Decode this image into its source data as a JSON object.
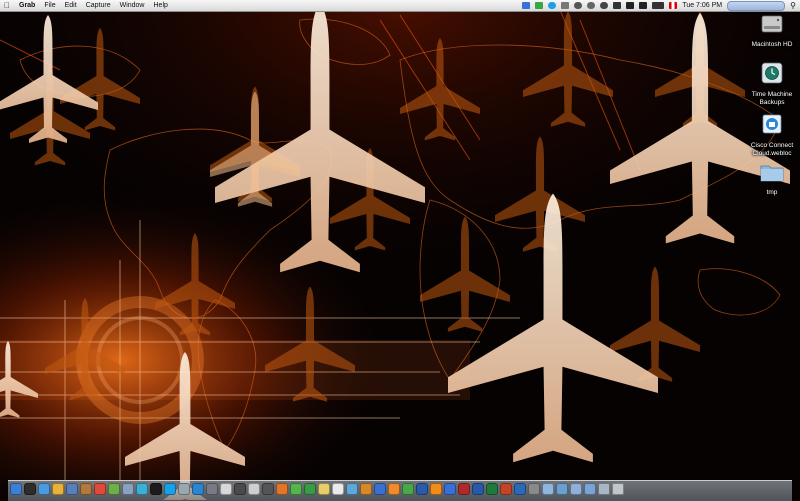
{
  "menubar": {
    "app_name": "Grab",
    "menus": [
      "File",
      "Edit",
      "Capture",
      "Window",
      "Help"
    ],
    "clock": "Tue 7:06 PM"
  },
  "desktop_icons": [
    {
      "name": "macintosh-hd",
      "label": "Macintosh HD",
      "icon": "hard-drive-icon"
    },
    {
      "name": "time-machine-backups",
      "label": "Time Machine Backups",
      "icon": "time-machine-icon"
    },
    {
      "name": "cisco-connect-cloud",
      "label": "Cisco Connect Cloud.webloc",
      "icon": "webloc-icon"
    },
    {
      "name": "tmp",
      "label": "tmp",
      "icon": "folder-icon"
    }
  ],
  "dock": {
    "apps": [
      "finder",
      "dashboard",
      "safari",
      "chrome",
      "mail",
      "contacts",
      "calendar",
      "photos",
      "preview",
      "itunes",
      "terminal",
      "skype",
      "grab",
      "app-store",
      "system-preferences",
      "textedit",
      "activity-monitor",
      "console",
      "calculator",
      "firefox",
      "messages",
      "facetime",
      "notes",
      "reminders",
      "maps",
      "ibooks",
      "keynote",
      "pages",
      "numbers",
      "xcode",
      "vlc",
      "dropbox",
      "filezilla",
      "word",
      "excel",
      "powerpoint",
      "outlook",
      "vmware",
      "folder",
      "downloads",
      "documents",
      "applications",
      "stack",
      "trash"
    ]
  }
}
